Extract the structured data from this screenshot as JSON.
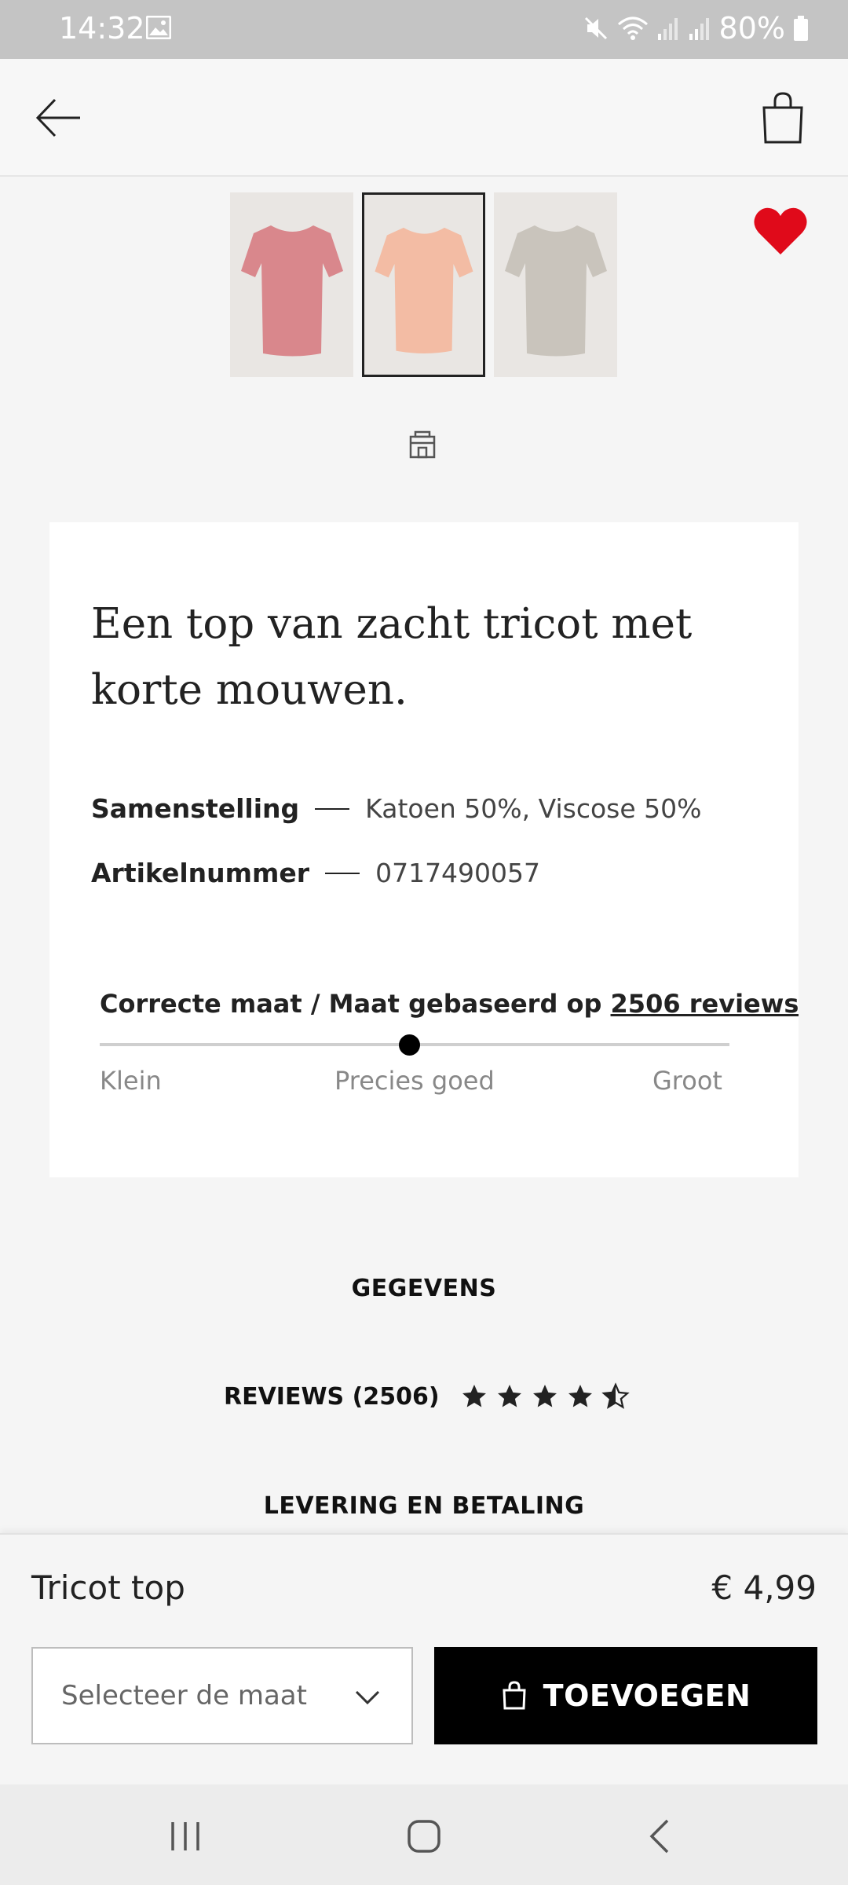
{
  "status_bar": {
    "time": "14:32",
    "battery": "80%",
    "icons": [
      "gallery-icon",
      "mute-icon",
      "wifi-icon",
      "signal-icon",
      "signal-icon",
      "battery-icon"
    ]
  },
  "app_bar": {
    "back_icon": "arrow-left-icon",
    "bag_icon": "shopping-bag-icon"
  },
  "gallery": {
    "thumbnails": [
      {
        "color": "#d9878c",
        "selected": false
      },
      {
        "color": "#f3bca4",
        "selected": true
      },
      {
        "color": "#c9c4bc",
        "selected": false
      }
    ],
    "favorite_icon": "heart-icon",
    "favorite_color": "#e00a1a",
    "store_icon": "store-icon"
  },
  "product": {
    "description": "Een top van zacht tricot met korte mouwen.",
    "specs": [
      {
        "label": "Samenstelling",
        "value": "Katoen 50%, Viscose 50%"
      },
      {
        "label": "Artikelnummer",
        "value": "0717490057"
      }
    ],
    "fit": {
      "title": "Correcte maat / Maat gebaseerd op",
      "link": "2506 reviews",
      "labels": [
        "Klein",
        "Precies goed",
        "Groot"
      ],
      "position": 0.5
    }
  },
  "sections": {
    "details": "GEGEVENS",
    "reviews_label": "REVIEWS (2506)",
    "rating": 4.5,
    "delivery": "LEVERING EN BETALING"
  },
  "bottom": {
    "product_name": "Tricot top",
    "price": "€ 4,99",
    "size_placeholder": "Selecteer de maat",
    "add_button": "TOEVOEGEN"
  },
  "nav_bar": {
    "icons": [
      "recent-apps-icon",
      "home-icon",
      "back-icon"
    ]
  }
}
